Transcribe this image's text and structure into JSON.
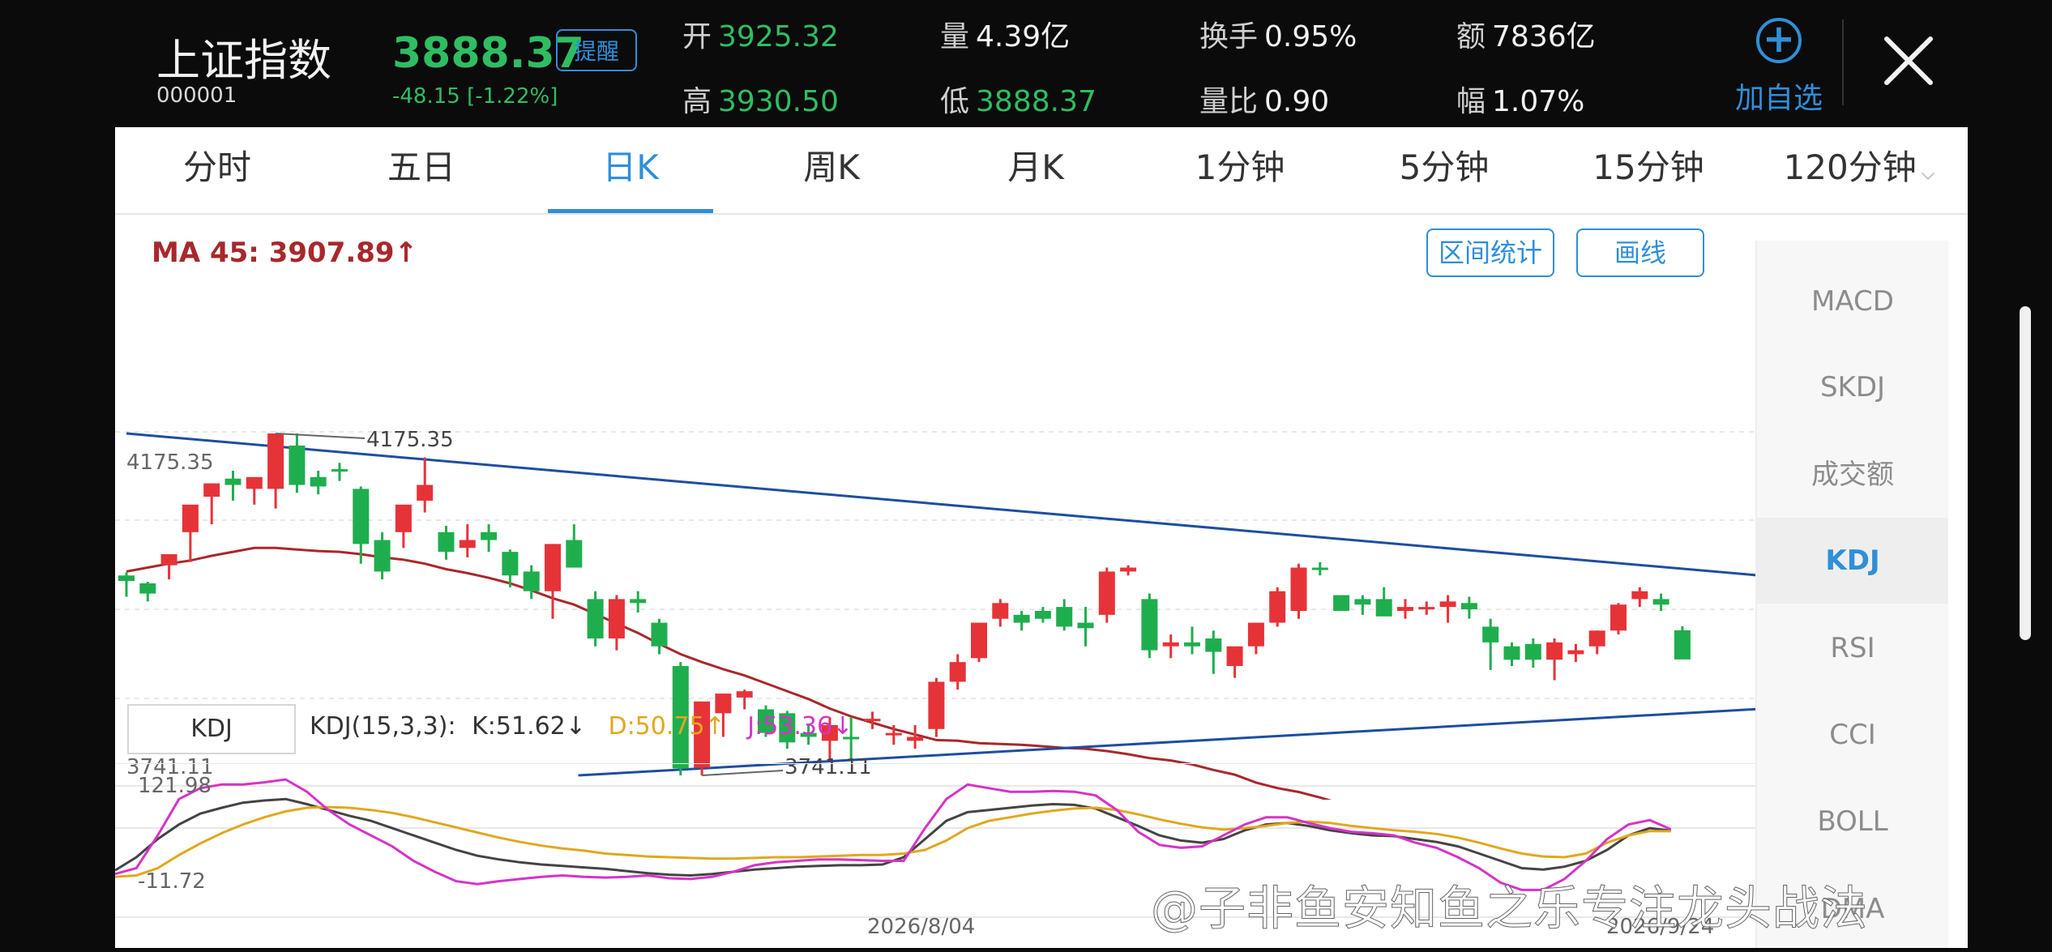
{
  "header": {
    "name": "上证指数",
    "code": "000001",
    "price": "3888.37",
    "change": "-48.15",
    "change_pct": "[-1.22%]",
    "remind_label": "提醒",
    "stats": [
      {
        "label": "开",
        "value": "3925.32"
      },
      {
        "label": "量",
        "value": "4.39亿"
      },
      {
        "label": "换手",
        "value": "0.95%"
      },
      {
        "label": "额",
        "value": "7836亿"
      },
      {
        "label": "高",
        "value": "3930.50"
      },
      {
        "label": "低",
        "value": "3888.37"
      },
      {
        "label": "量比",
        "value": "0.90"
      },
      {
        "label": "幅",
        "value": "1.07%"
      }
    ],
    "add_label": "加自选",
    "add_icon": "plus-circle-icon",
    "close_icon": "close-icon"
  },
  "tabs": [
    {
      "label": "分时"
    },
    {
      "label": "五日"
    },
    {
      "label": "日K",
      "active": true
    },
    {
      "label": "周K"
    },
    {
      "label": "月K"
    },
    {
      "label": "1分钟"
    },
    {
      "label": "5分钟"
    },
    {
      "label": "15分钟"
    },
    {
      "label": "120分钟"
    }
  ],
  "ma_label": "MA 45: 3907.89↑",
  "buttons": {
    "range_stats": "区间统计",
    "draw": "画线"
  },
  "indicators": [
    {
      "label": "MACD"
    },
    {
      "label": "SKDJ"
    },
    {
      "label": "成交额"
    },
    {
      "label": "KDJ",
      "active": true
    },
    {
      "label": "RSI"
    },
    {
      "label": "CCI"
    },
    {
      "label": "BOLL"
    },
    {
      "label": "DMA"
    }
  ],
  "kdj_box": "KDJ",
  "kdj_info": {
    "params": "KDJ(15,3,3):",
    "k": "K:51.62↓",
    "d": "D:50.75↑",
    "j": "J:53.36↓"
  },
  "watermark": "@子非鱼安知鱼之乐专注龙头战法",
  "colors": {
    "up": "#e63338",
    "down": "#1fae4e",
    "ma": "#a8282c",
    "trend": "#1e4ea0",
    "k": "#444444",
    "d": "#e0a81f",
    "j": "#d633c8",
    "accent": "#2f8fd8"
  },
  "chart_data": [
    {
      "type": "candlestick",
      "price_labels": [
        "4175.35",
        "3741.11"
      ],
      "high_mark": "4175.35",
      "low_mark": "3741.11",
      "ma_label": "MA 45: 3907.89",
      "last": {
        "open": 3925.32,
        "high": 3930.5,
        "low": 3888.37,
        "close": 3888.37
      },
      "candles": [
        [
          3995,
          3999,
          3968,
          3988
        ],
        [
          3985,
          3987,
          3962,
          3972
        ],
        [
          4008,
          4018,
          3990,
          4022
        ],
        [
          4050,
          4060,
          4012,
          4085
        ],
        [
          4095,
          4102,
          4060,
          4112
        ],
        [
          4118,
          4128,
          4090,
          4110
        ],
        [
          4105,
          4115,
          4085,
          4120
        ],
        [
          4105,
          4170,
          4080,
          4175.35
        ],
        [
          4160,
          4175.35,
          4100,
          4110
        ],
        [
          4120,
          4128,
          4098,
          4108
        ],
        [
          4130,
          4138,
          4115,
          4128
        ],
        [
          4105,
          4108,
          4010,
          4035
        ],
        [
          4040,
          4050,
          3990,
          4000
        ],
        [
          4050,
          4060,
          4030,
          4085
        ],
        [
          4090,
          4145,
          4075,
          4110
        ],
        [
          4050,
          4058,
          4015,
          4025
        ],
        [
          4030,
          4060,
          4018,
          4040
        ],
        [
          4050,
          4060,
          4025,
          4040
        ],
        [
          4025,
          4028,
          3980,
          3995
        ],
        [
          4000,
          4008,
          3965,
          3975
        ],
        [
          3975,
          4035,
          3940,
          4035
        ],
        [
          4040,
          4060,
          4010,
          4005
        ],
        [
          3965,
          3975,
          3905,
          3915
        ],
        [
          3915,
          3970,
          3900,
          3965
        ],
        [
          3965,
          3975,
          3948,
          3960
        ],
        [
          3935,
          3940,
          3895,
          3905
        ],
        [
          3880,
          3885,
          3741.11,
          3750
        ],
        [
          3751,
          3775,
          3741.11,
          3835
        ],
        [
          3820,
          3845,
          3790,
          3845
        ],
        [
          3840,
          3850,
          3825,
          3848
        ],
        [
          3825,
          3830,
          3790,
          3795
        ],
        [
          3820,
          3823,
          3775,
          3783
        ],
        [
          3795,
          3805,
          3780,
          3790
        ],
        [
          3785,
          3815,
          3760,
          3805
        ],
        [
          3790,
          3815,
          3760,
          3788
        ],
        [
          3810,
          3822,
          3800,
          3813
        ],
        [
          3795,
          3805,
          3780,
          3795
        ],
        [
          3785,
          3805,
          3775,
          3790
        ],
        [
          3800,
          3865,
          3790,
          3860
        ],
        [
          3860,
          3895,
          3850,
          3885
        ],
        [
          3890,
          3935,
          3885,
          3935
        ],
        [
          3940,
          3965,
          3930,
          3960
        ],
        [
          3945,
          3950,
          3925,
          3935
        ],
        [
          3950,
          3955,
          3935,
          3940
        ],
        [
          3955,
          3965,
          3925,
          3930
        ],
        [
          3935,
          3955,
          3905,
          3928
        ],
        [
          3945,
          4005,
          3935,
          4000
        ],
        [
          4000,
          4008,
          3995,
          4005
        ],
        [
          3965,
          3972,
          3890,
          3900
        ],
        [
          3905,
          3920,
          3890,
          3910
        ],
        [
          3910,
          3930,
          3895,
          3905
        ],
        [
          3915,
          3925,
          3870,
          3898
        ],
        [
          3880,
          3900,
          3865,
          3905
        ],
        [
          3905,
          3935,
          3895,
          3935
        ],
        [
          3935,
          3980,
          3930,
          3975
        ],
        [
          3950,
          4010,
          3940,
          4005
        ],
        [
          4005,
          4012,
          3995,
          4003
        ],
        [
          3970,
          3968,
          3955,
          3950
        ],
        [
          3965,
          3970,
          3945,
          3958
        ],
        [
          3965,
          3980,
          3945,
          3943
        ],
        [
          3950,
          3965,
          3940,
          3955
        ],
        [
          3955,
          3962,
          3945,
          3955
        ],
        [
          3955,
          3970,
          3935,
          3962
        ],
        [
          3960,
          3968,
          3940,
          3952
        ],
        [
          3930,
          3940,
          3875,
          3910
        ],
        [
          3905,
          3910,
          3880,
          3888
        ],
        [
          3908,
          3915,
          3878,
          3888
        ],
        [
          3888,
          3915,
          3862,
          3910
        ],
        [
          3895,
          3908,
          3885,
          3900
        ],
        [
          3905,
          3925,
          3895,
          3925
        ],
        [
          3925,
          3960,
          3920,
          3958
        ],
        [
          3965,
          3980,
          3955,
          3975
        ],
        [
          3965,
          3972,
          3950,
          3958
        ],
        [
          3925.32,
          3930.5,
          3888.37,
          3888.37
        ]
      ],
      "ma": [
        4000,
        4005,
        4010,
        4014,
        4020,
        4025,
        4030,
        4030,
        4028,
        4026,
        4025,
        4022,
        4018,
        4015,
        4010,
        4003,
        3998,
        3992,
        3985,
        3976,
        3966,
        3958,
        3946,
        3934,
        3922,
        3908,
        3895,
        3885,
        3876,
        3868,
        3858,
        3848,
        3838,
        3826,
        3816,
        3808,
        3800,
        3793,
        3786,
        3785,
        3782,
        3781,
        3780,
        3778,
        3776,
        3775,
        3772,
        3768,
        3763,
        3760,
        3755,
        3748,
        3742,
        3732,
        3725,
        3720,
        3713,
        3705,
        3699,
        3687,
        3670,
        3668,
        3667,
        3665,
        3662,
        3660,
        3656,
        3655,
        3653,
        3655,
        3655,
        3655,
        3657,
        3657
      ],
      "trend_lines": [
        {
          "from": [
            0,
            4175.35
          ],
          "to": [
            79.6,
            3988
          ]
        },
        {
          "from": [
            21.2,
            3741.11
          ],
          "to": [
            79.6,
            3830
          ]
        }
      ]
    },
    {
      "type": "line",
      "title": "KDJ(15,3,3)",
      "y_labels": [
        "121.98",
        "-11.72"
      ],
      "x_labels": [
        "2026/8/04",
        "2026/9/24"
      ],
      "series": [
        {
          "name": "K",
          "values": [
            -3,
            15,
            40,
            60,
            75,
            83,
            90,
            93,
            95,
            88,
            80,
            72,
            65,
            55,
            45,
            35,
            25,
            17,
            12,
            8,
            5,
            3,
            1,
            -1,
            -4,
            -7,
            -9,
            -10,
            -8,
            -5,
            -2,
            0,
            2,
            3,
            4,
            4,
            5,
            15,
            40,
            65,
            77,
            80,
            83,
            86,
            88,
            87,
            82,
            70,
            58,
            45,
            38,
            35,
            40,
            52,
            60,
            62,
            58,
            52,
            48,
            45,
            44,
            40,
            36,
            30,
            20,
            10,
            0,
            -2,
            2,
            10,
            25,
            45,
            55,
            51.62
          ]
        },
        {
          "name": "D",
          "values": [
            -12,
            -10,
            0,
            18,
            34,
            48,
            60,
            70,
            78,
            83,
            84,
            83,
            80,
            76,
            70,
            63,
            56,
            49,
            42,
            36,
            31,
            27,
            24,
            20,
            18,
            16,
            15,
            14,
            13,
            13,
            14,
            15,
            15,
            16,
            17,
            18,
            18,
            20,
            25,
            38,
            55,
            65,
            70,
            75,
            79,
            82,
            83,
            80,
            74,
            67,
            61,
            56,
            53,
            55,
            58,
            62,
            64,
            62,
            58,
            55,
            52,
            50,
            47,
            42,
            35,
            27,
            20,
            16,
            15,
            20,
            35,
            45,
            51,
            50.75
          ]
        },
        {
          "name": "J",
          "values": [
            -8,
            0,
            45,
            95,
            110,
            115,
            115,
            118,
            121.98,
            105,
            80,
            60,
            45,
            30,
            10,
            -5,
            -18,
            -22,
            -18,
            -15,
            -12,
            -10,
            -12,
            -13,
            -12,
            -10,
            -14,
            -15,
            -12,
            -5,
            4,
            8,
            10,
            12,
            12,
            11,
            10,
            10,
            55,
            95,
            115,
            110,
            105,
            105,
            106,
            105,
            100,
            80,
            50,
            32,
            28,
            30,
            45,
            60,
            70,
            70,
            62,
            55,
            50,
            48,
            45,
            35,
            28,
            15,
            0,
            -20,
            -30,
            -30,
            -15,
            10,
            40,
            60,
            66,
            53.36
          ]
        }
      ]
    }
  ]
}
